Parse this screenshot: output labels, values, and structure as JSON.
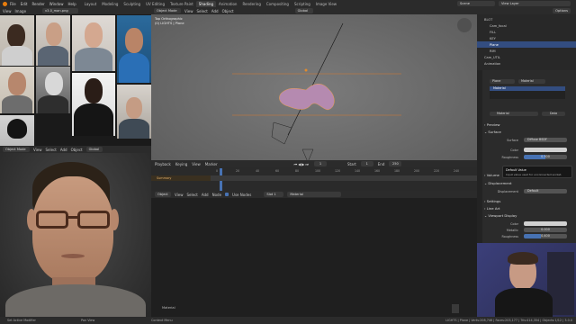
{
  "topbar": {
    "menu": [
      "File",
      "Edit",
      "Render",
      "Window",
      "Help"
    ],
    "tabs": [
      "Layout",
      "Modeling",
      "Sculpting",
      "UV Editing",
      "Texture Paint",
      "Shading",
      "Animation",
      "Rendering",
      "Compositing",
      "Scripting",
      "Image View"
    ],
    "active_tab": "Shading",
    "scene_label": "Scene",
    "view_layer_label": "View Layer"
  },
  "image_editor": {
    "header": [
      "View",
      "Image"
    ],
    "image_name": "v3.0_man.png"
  },
  "viewport": {
    "mode": "Object Mode",
    "menu": [
      "View",
      "Select",
      "Add",
      "Object"
    ],
    "transform": "Global",
    "overlay_title": "Top Orthographic",
    "overlay_sub": "(0) LIGHTS | Plane"
  },
  "timeline": {
    "menu": [
      "Playback",
      "Keying",
      "View",
      "Marker"
    ],
    "summary_label": "Summary",
    "start_label": "Start",
    "start_value": "1",
    "end_label": "End",
    "end_value": "250",
    "ticks": [
      "0",
      "20",
      "40",
      "60",
      "80",
      "100",
      "120",
      "140",
      "160",
      "180",
      "200",
      "220",
      "240"
    ],
    "current_frame": "1"
  },
  "node_editor": {
    "mode": "Object",
    "menu": [
      "View",
      "Select",
      "Add",
      "Node"
    ],
    "use_nodes_label": "Use Nodes",
    "slot": "Slot 1",
    "material": "Material",
    "footer_label": "Material"
  },
  "face_panel": {
    "mode": "Object Mode",
    "menu": [
      "View",
      "Select",
      "Add",
      "Object"
    ],
    "transform": "Global"
  },
  "outliner": {
    "header": "Options",
    "items": [
      {
        "label": "BLOT",
        "indent": 1
      },
      {
        "label": "Cam_focal",
        "indent": 2
      },
      {
        "label": "FILL",
        "indent": 2
      },
      {
        "label": "KEY",
        "indent": 2
      },
      {
        "label": "Plane",
        "indent": 2,
        "selected": true
      },
      {
        "label": "RIM",
        "indent": 2
      },
      {
        "label": "Cam_UTIL",
        "indent": 1
      },
      {
        "label": "Animation",
        "indent": 1
      }
    ]
  },
  "properties": {
    "object_name": "Plane",
    "material_tab": "Material",
    "slot_name": "Material",
    "material_name": "Material",
    "data_label": "Data",
    "preview": "Preview",
    "surface": "Surface",
    "surface_label": "Surface",
    "surface_value": "Diffuse BSDF",
    "color_label": "Color",
    "roughness_label": "Roughness",
    "roughness_value": "0.500",
    "tooltip_title": "Default Value",
    "tooltip_body": "Input value used for unconnected socket.",
    "volume": "Volume",
    "displacement_section": "Displacement",
    "displacement_label": "Displacement",
    "displacement_value": "Default",
    "settings": "Settings",
    "line_art": "Line Art",
    "viewport_display": "Viewport Display",
    "vd_color_label": "Color",
    "metallic_label": "Metallic",
    "metallic_value": "0.000",
    "vd_roughness_label": "Roughness",
    "vd_roughness_value": "0.400"
  },
  "statusbar": {
    "left": "Set Active Modifier",
    "middle1": "Pan View",
    "middle2": "Context Menu",
    "right": "LIGHTS | Plane | Verts:208,746 | Faces:203,177 | Tris:414,354 | Objects:1/12 | 3.0.0"
  },
  "colors": {
    "accent_blue": "#4772b3",
    "orange": "#e08a2e",
    "selected_row": "#334d80"
  }
}
